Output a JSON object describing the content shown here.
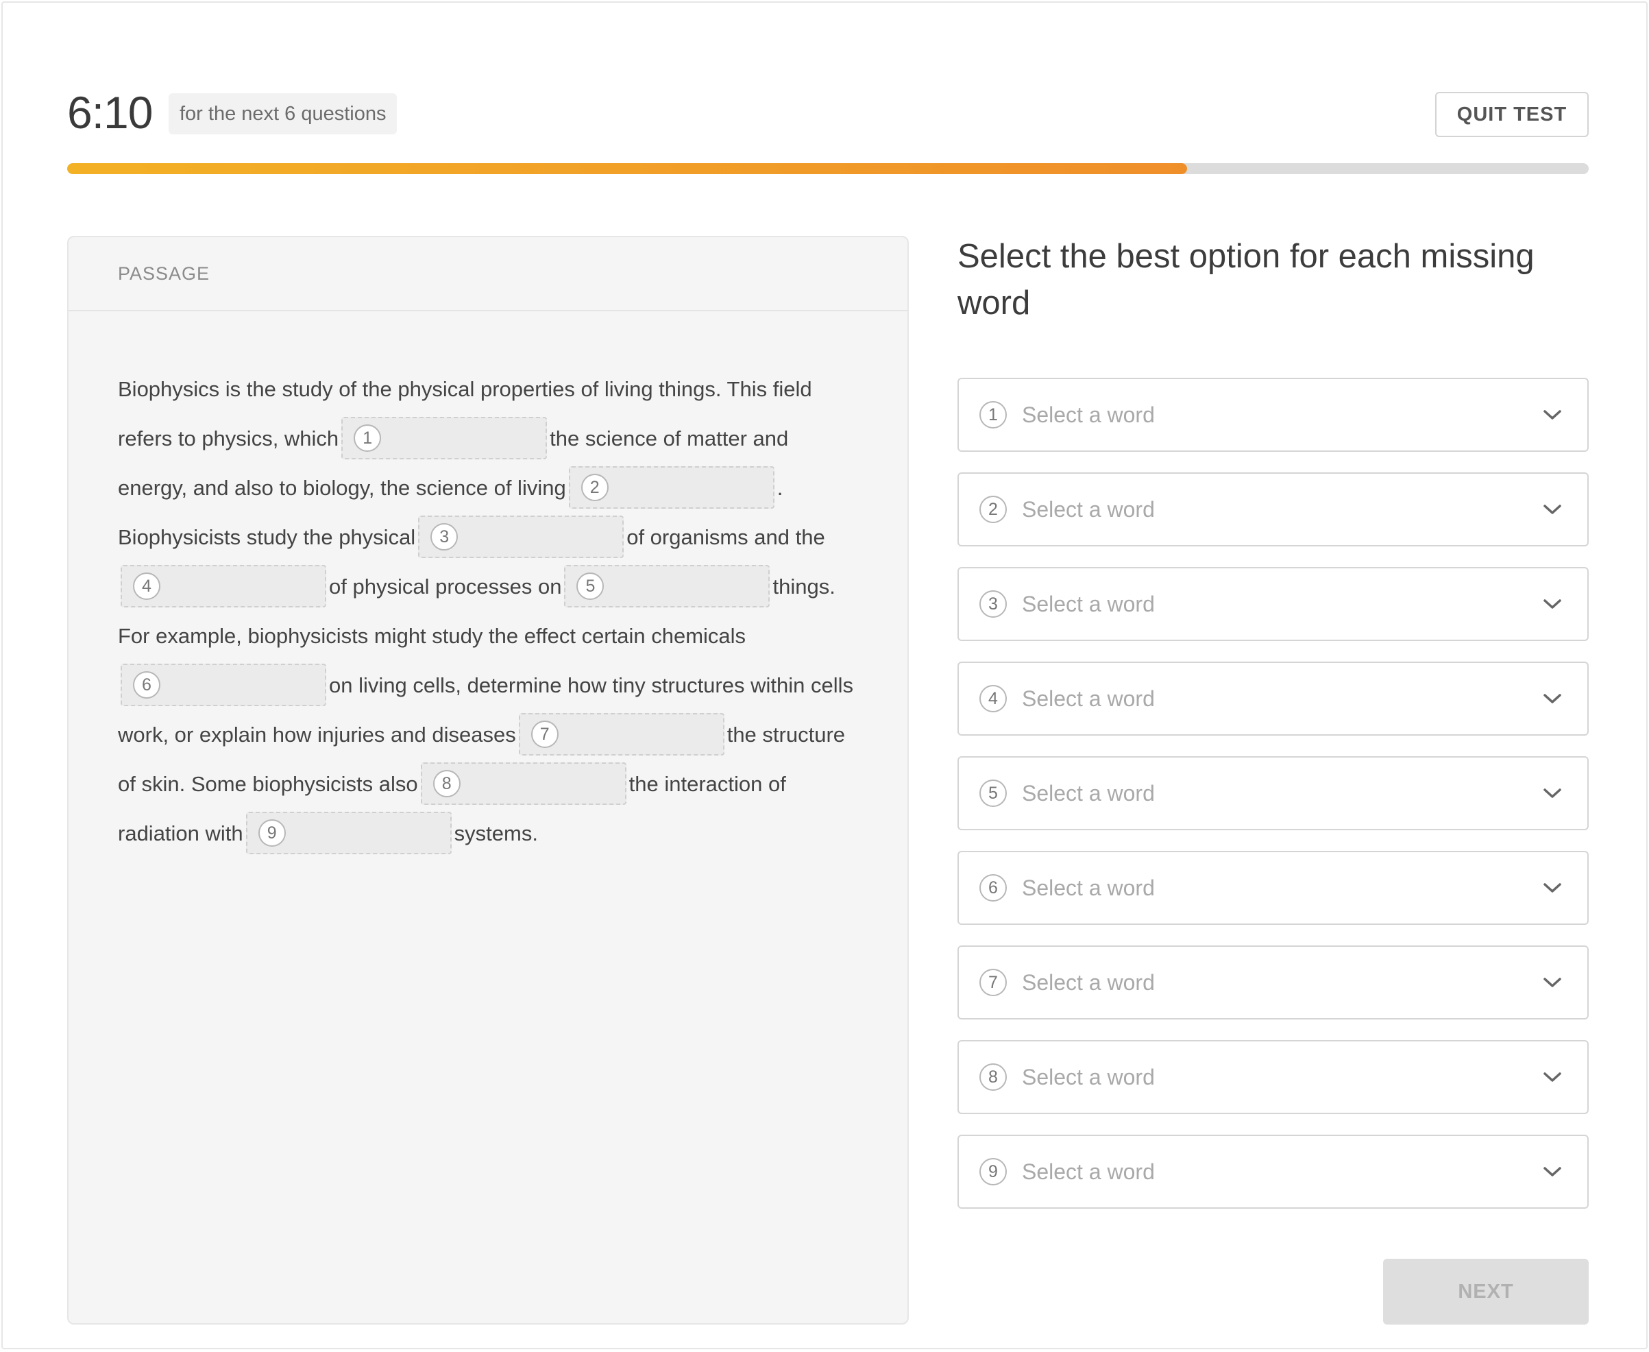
{
  "header": {
    "timer": "6:10",
    "timer_note": "for the next 6 questions",
    "quit_label": "QUIT TEST",
    "progress_percent": 73.6
  },
  "passage": {
    "heading": "PASSAGE",
    "segments": [
      "Biophysics is the study of the physical properties of living things. This field refers to physics, which",
      "the science of matter and energy, and also to biology, the science of living",
      ". Biophysicists study the physical",
      "of organisms and the",
      "of physical processes on",
      "things. For example, biophysicists might study the effect certain chemicals",
      "on living cells, determine how tiny structures within cells work, or explain how injuries and diseases",
      "the structure of skin. Some biophysicists also",
      "the interaction of radiation with",
      "systems."
    ],
    "blanks": [
      "1",
      "2",
      "3",
      "4",
      "5",
      "6",
      "7",
      "8",
      "9"
    ]
  },
  "question": {
    "instructions": "Select the best option for each missing word",
    "dropdowns": [
      {
        "number": "1",
        "placeholder": "Select a word"
      },
      {
        "number": "2",
        "placeholder": "Select a word"
      },
      {
        "number": "3",
        "placeholder": "Select a word"
      },
      {
        "number": "4",
        "placeholder": "Select a word"
      },
      {
        "number": "5",
        "placeholder": "Select a word"
      },
      {
        "number": "6",
        "placeholder": "Select a word"
      },
      {
        "number": "7",
        "placeholder": "Select a word"
      },
      {
        "number": "8",
        "placeholder": "Select a word"
      },
      {
        "number": "9",
        "placeholder": "Select a word"
      }
    ],
    "next_label": "NEXT"
  },
  "icons": {
    "dropdown_arrow": "chevron-down-icon"
  },
  "colors": {
    "progress_start": "#f3b126",
    "progress_end": "#ef8f2a",
    "progress_track": "#dcdcdc",
    "panel_bg": "#f5f5f5",
    "next_disabled_bg": "#dedede"
  }
}
